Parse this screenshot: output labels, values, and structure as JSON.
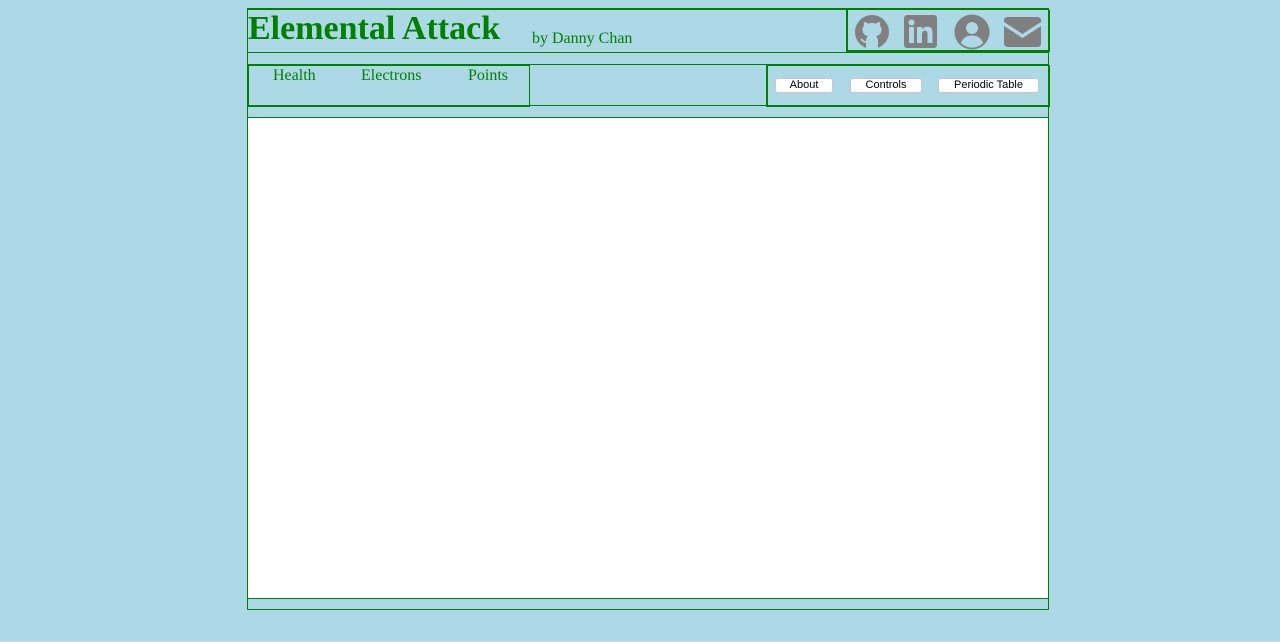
{
  "header": {
    "title": "Elemental Attack",
    "byline": "by Danny Chan"
  },
  "social_icons": [
    {
      "name": "github-icon",
      "color": "#808080"
    },
    {
      "name": "linkedin-icon",
      "color": "#808080"
    },
    {
      "name": "user-circle-icon",
      "color": "#808080"
    },
    {
      "name": "envelope-icon",
      "color": "#808080"
    }
  ],
  "stats": {
    "health_label": "Health",
    "electrons_label": "Electrons",
    "points_label": "Points"
  },
  "menu": {
    "about_label": "About",
    "controls_label": "Controls",
    "periodic_table_label": "Periodic Table"
  },
  "colors": {
    "background": "#add8e6",
    "accent": "#008000",
    "icon": "#808080",
    "canvas": "#ffffff"
  }
}
